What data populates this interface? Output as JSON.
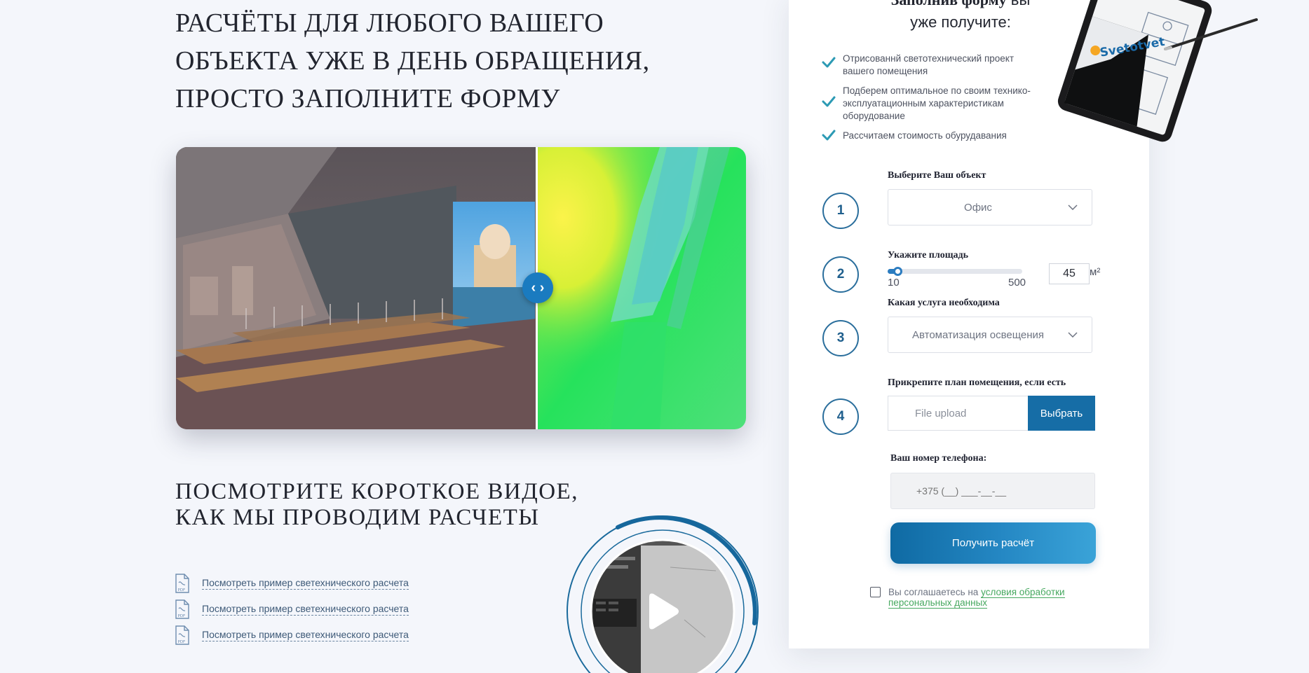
{
  "hero": {
    "title_lines": [
      "РАСЧЁТЫ ДЛЯ ЛЮБОГО ВАШЕГО",
      "ОБЪЕКТА УЖЕ В ДЕНЬ ОБРАЩЕНИЯ,",
      "ПРОСТО ЗАПОЛНИТЕ ФОРМУ"
    ]
  },
  "compare": {
    "handle_icon": "left-right-arrows-icon",
    "handle_glyph": "‹ ›"
  },
  "video": {
    "title_lines": [
      "ПОСМОТРИТЕ КОРОТКОЕ ВИДОЕ,",
      "КАК МЫ ПРОВОДИМ РАСЧЕТЫ"
    ],
    "play_icon": "play-icon"
  },
  "pdf_links": [
    {
      "icon": "pdf-icon",
      "text": "Посмотреть пример светехнического расчета"
    },
    {
      "icon": "pdf-icon",
      "text": "Посмотреть пример светехнического расчета"
    },
    {
      "icon": "pdf-icon",
      "text": "Посмотреть пример светехнического расчета"
    }
  ],
  "form": {
    "title_bold": "Заполнив форму",
    "title_rest_1": "вы",
    "title_rest_2": "уже получите:",
    "tablet_logo": "Svetotvet",
    "benefits": [
      "Отрисованнй светотехнический проект вашего помещения",
      "Подберем оптимальное по своим технико-эксплуатационным характеристикам оборудование",
      "Рассчитаем стоимость обурудавания"
    ],
    "steps": [
      {
        "num": "1",
        "label": "Выберите Ваш объект",
        "value": "Офис"
      },
      {
        "num": "2",
        "label": "Укажите площадь",
        "slider_min": "10",
        "slider_max": "500",
        "area_value": "45",
        "unit": "м²",
        "slider_fraction": 0.071
      },
      {
        "num": "3",
        "label": "Какая услуга необходима",
        "value": "Автоматизация освещения"
      },
      {
        "num": "4",
        "label": "Прикрепите план помещения, если есть",
        "upload_placeholder": "File upload",
        "upload_button": "Выбрать"
      }
    ],
    "phone_label": "Ваш номер телефона:",
    "phone_placeholder": "+375 (__) ___-__-__",
    "submit_label": "Получить расчёт",
    "consent_text": "Вы соглашаетесь на",
    "consent_link": "условия обработки персональных данных"
  },
  "colors": {
    "accent": "#166da6",
    "check": "#2c9ab4",
    "link_green": "#46a85f",
    "background": "#f4f6fb"
  }
}
